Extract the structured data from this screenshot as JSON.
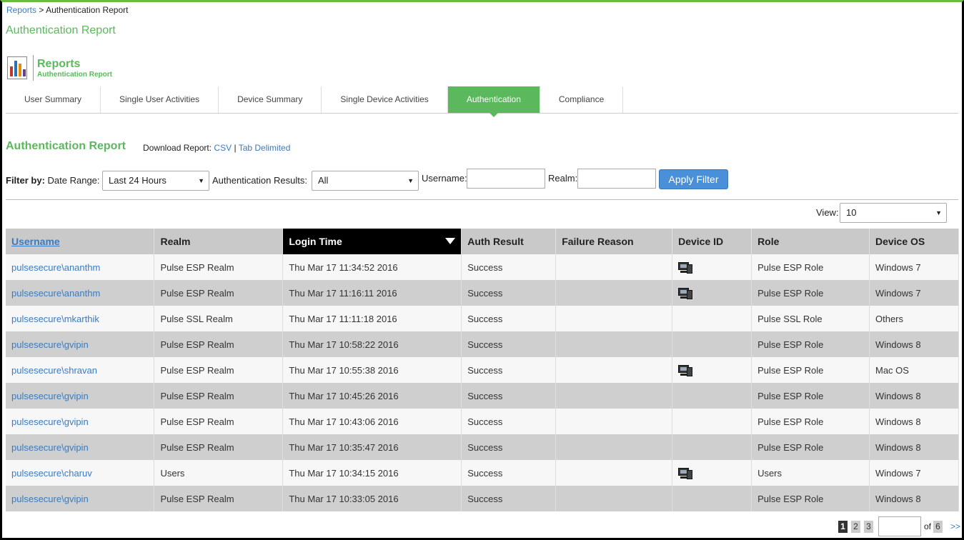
{
  "breadcrumb": {
    "link": "Reports",
    "separator": ">",
    "current": "Authentication Report"
  },
  "page_title": "Authentication Report",
  "module": {
    "title": "Reports",
    "subtitle": "Authentication Report",
    "icon": "bar-chart-report-icon"
  },
  "tabs": [
    {
      "label": "User Summary",
      "active": false
    },
    {
      "label": "Single User Activities",
      "active": false
    },
    {
      "label": "Device Summary",
      "active": false
    },
    {
      "label": "Single Device Activities",
      "active": false
    },
    {
      "label": "Authentication",
      "active": true
    },
    {
      "label": "Compliance",
      "active": false
    }
  ],
  "section": {
    "title": "Authentication Report",
    "download_label": "Download Report:",
    "download_csv": "CSV",
    "download_sep": "|",
    "download_tab": "Tab Delimited"
  },
  "filter": {
    "filter_by": "Filter by:",
    "date_range_label": "Date Range:",
    "date_range_value": "Last 24 Hours",
    "auth_results_label": "Authentication Results:",
    "auth_results_value": "All",
    "username_label": "Username:",
    "username_value": "",
    "realm_label": "Realm:",
    "realm_value": "",
    "apply_label": "Apply Filter"
  },
  "view": {
    "label": "View:",
    "value": "10"
  },
  "table": {
    "columns": [
      "Username",
      "Realm",
      "Login Time",
      "Auth Result",
      "Failure Reason",
      "Device ID",
      "Role",
      "Device OS"
    ],
    "sorted_column": "Login Time",
    "rows": [
      {
        "username": "pulsesecure\\ananthm",
        "realm": "Pulse ESP Realm",
        "login_time": "Thu Mar 17 11:34:52 2016",
        "auth_result": "Success",
        "failure_reason": "",
        "device": true,
        "role": "Pulse ESP Role",
        "os": "Windows 7"
      },
      {
        "username": "pulsesecure\\ananthm",
        "realm": "Pulse ESP Realm",
        "login_time": "Thu Mar 17 11:16:11 2016",
        "auth_result": "Success",
        "failure_reason": "",
        "device": true,
        "role": "Pulse ESP Role",
        "os": "Windows 7"
      },
      {
        "username": "pulsesecure\\mkarthik",
        "realm": "Pulse SSL Realm",
        "login_time": "Thu Mar 17 11:11:18 2016",
        "auth_result": "Success",
        "failure_reason": "",
        "device": false,
        "role": "Pulse SSL Role",
        "os": "Others"
      },
      {
        "username": "pulsesecure\\gvipin",
        "realm": "Pulse ESP Realm",
        "login_time": "Thu Mar 17 10:58:22 2016",
        "auth_result": "Success",
        "failure_reason": "",
        "device": false,
        "role": "Pulse ESP Role",
        "os": "Windows 8"
      },
      {
        "username": "pulsesecure\\shravan",
        "realm": "Pulse ESP Realm",
        "login_time": "Thu Mar 17 10:55:38 2016",
        "auth_result": "Success",
        "failure_reason": "",
        "device": true,
        "role": "Pulse ESP Role",
        "os": "Mac OS"
      },
      {
        "username": "pulsesecure\\gvipin",
        "realm": "Pulse ESP Realm",
        "login_time": "Thu Mar 17 10:45:26 2016",
        "auth_result": "Success",
        "failure_reason": "",
        "device": false,
        "role": "Pulse ESP Role",
        "os": "Windows 8"
      },
      {
        "username": "pulsesecure\\gvipin",
        "realm": "Pulse ESP Realm",
        "login_time": "Thu Mar 17 10:43:06 2016",
        "auth_result": "Success",
        "failure_reason": "",
        "device": false,
        "role": "Pulse ESP Role",
        "os": "Windows 8"
      },
      {
        "username": "pulsesecure\\gvipin",
        "realm": "Pulse ESP Realm",
        "login_time": "Thu Mar 17 10:35:47 2016",
        "auth_result": "Success",
        "failure_reason": "",
        "device": false,
        "role": "Pulse ESP Role",
        "os": "Windows 8"
      },
      {
        "username": "pulsesecure\\charuv",
        "realm": "Users",
        "login_time": "Thu Mar 17 10:34:15 2016",
        "auth_result": "Success",
        "failure_reason": "",
        "device": true,
        "role": "Users",
        "os": "Windows 7"
      },
      {
        "username": "pulsesecure\\gvipin",
        "realm": "Pulse ESP Realm",
        "login_time": "Thu Mar 17 10:33:05 2016",
        "auth_result": "Success",
        "failure_reason": "",
        "device": false,
        "role": "Pulse ESP Role",
        "os": "Windows 8"
      }
    ]
  },
  "pager": {
    "pages": [
      "1",
      "2",
      "3"
    ],
    "current": "1",
    "of_label": "of",
    "total": "6",
    "next": ">>"
  },
  "colors": {
    "accent_green": "#5cb85c",
    "link_blue": "#3a7bbf",
    "button_blue": "#4a90d9"
  }
}
